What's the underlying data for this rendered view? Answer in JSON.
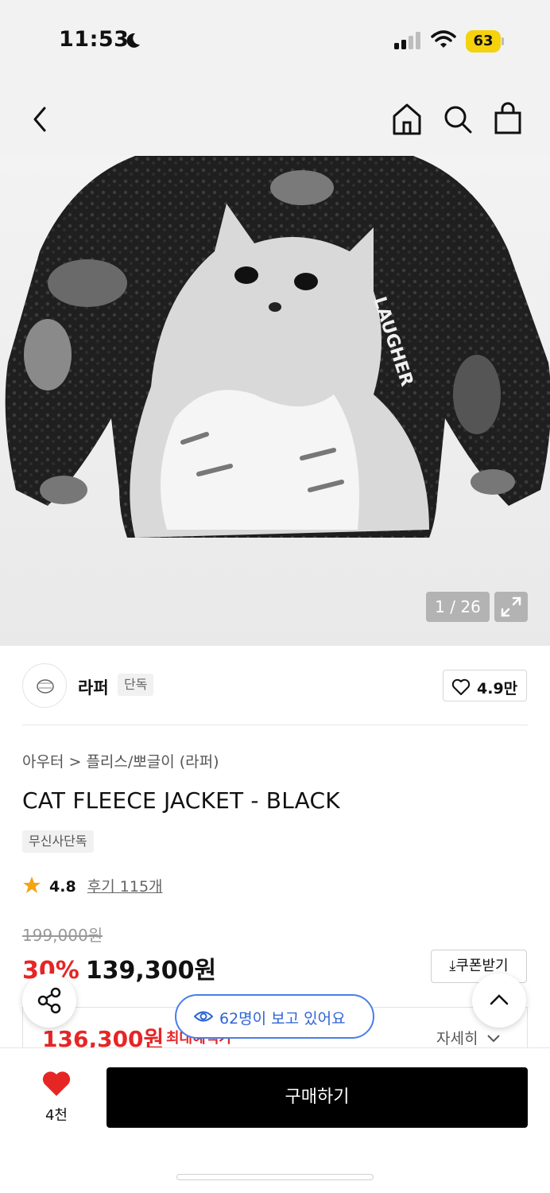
{
  "status_bar": {
    "time": "11:53",
    "battery": "63",
    "icons": [
      "moon-icon",
      "signal-icon",
      "wifi-icon",
      "battery-icon"
    ]
  },
  "nav": {
    "icons": [
      "back-icon",
      "home-icon",
      "search-icon",
      "cart-icon"
    ]
  },
  "gallery": {
    "counter": "1 / 26",
    "jacket_text": "LAUGHER"
  },
  "brand": {
    "name": "라퍼",
    "badge": "단독",
    "likes": "4.9만"
  },
  "product": {
    "breadcrumb": "아우터 > 플리스/뽀글이 (라퍼)",
    "title": "CAT FLEECE JACKET - BLACK",
    "tag": "무신사단독",
    "rating": "4.8",
    "reviews": "후기 115개",
    "original_price": "199,000원",
    "discount": "30%",
    "sale_price": "139,300원",
    "coupon_label": "쿠폰받기",
    "max_price": "136,300원",
    "max_label": "최대혜택가",
    "detail_label": "자세히"
  },
  "floating": {
    "viewers": "62명이 보고 있어요"
  },
  "bottom": {
    "wish_count": "4천",
    "buy_label": "구매하기"
  },
  "colors": {
    "accent_red": "#e62525",
    "viewer_blue": "#2f64d6",
    "battery_yellow": "#f5d20c"
  }
}
